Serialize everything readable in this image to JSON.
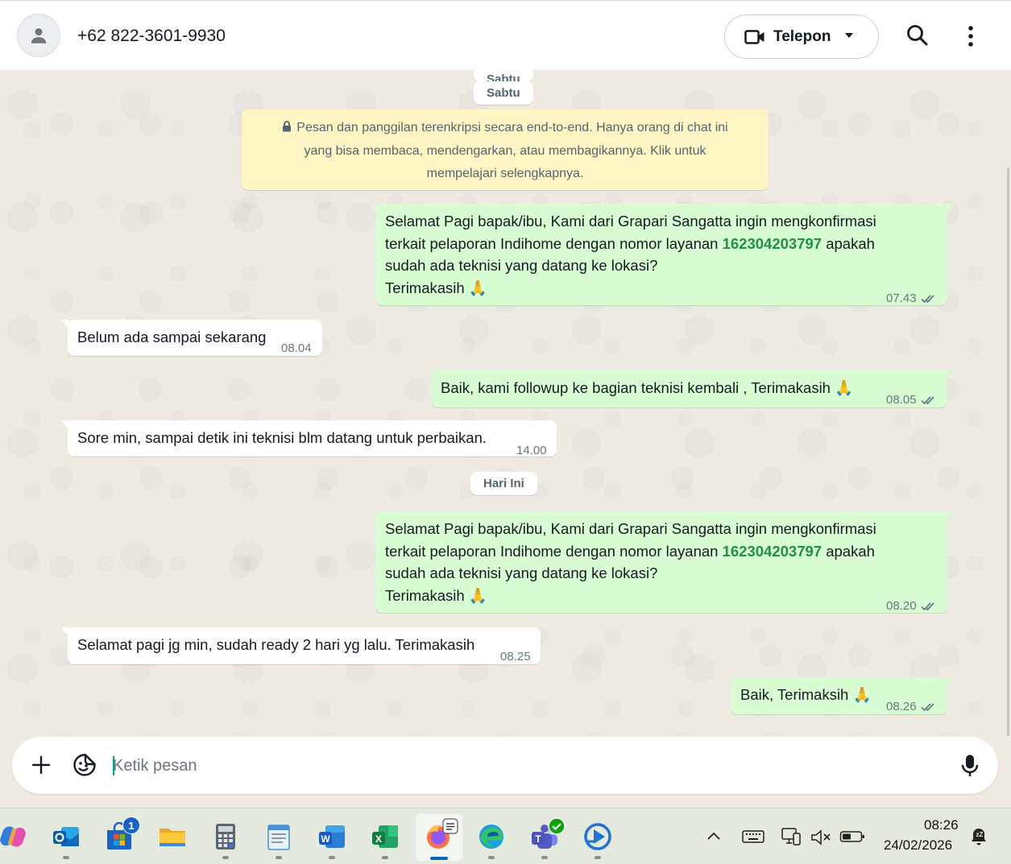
{
  "header": {
    "contact_name": "+62 822-3601-9930",
    "call_label": "Telepon"
  },
  "chat": {
    "date_sabtu_peek": "Sabtu",
    "date_sabtu": "Sabtu",
    "encryption_notice": "Pesan dan panggilan terenkripsi secara end-to-end. Hanya orang di chat ini yang bisa membaca, mendengarkan, atau membagikannya. Klik untuk mempelajari selengkapnya.",
    "date_today": "Hari Ini",
    "messages": [
      {
        "direction": "out",
        "line1": "Selamat Pagi bapak/ibu, Kami dari Grapari Sangatta ingin mengkonfirmasi",
        "line2_pre": "terkait pelaporan Indihome dengan nomor layanan ",
        "line2_link": "162304203797",
        "line2_post": " apakah",
        "line3": "sudah ada teknisi yang datang ke lokasi?",
        "line4": "Terimakasih 🙏",
        "time": "07.43",
        "status": "read"
      },
      {
        "direction": "in",
        "text": "Belum ada sampai sekarang",
        "time": "08.04"
      },
      {
        "direction": "out",
        "text": "Baik, kami followup ke bagian teknisi kembali , Terimakasih 🙏",
        "time": "08.05",
        "status": "read"
      },
      {
        "direction": "in",
        "text": "Sore min, sampai detik ini teknisi blm datang untuk perbaikan.",
        "time": "14.00"
      },
      {
        "direction": "out",
        "line1": "Selamat Pagi bapak/ibu, Kami dari Grapari Sangatta ingin mengkonfirmasi",
        "line2_pre": "terkait pelaporan Indihome dengan nomor layanan ",
        "line2_link": "162304203797",
        "line2_post": " apakah",
        "line3": "sudah ada teknisi yang datang ke lokasi?",
        "line4": "Terimakasih 🙏",
        "time": "08.20",
        "status": "read"
      },
      {
        "direction": "in",
        "text": "Selamat pagi jg min, sudah ready 2 hari yg lalu. Terimakasih",
        "time": "08.25"
      },
      {
        "direction": "out",
        "text": "Baik, Terimaksih 🙏",
        "time": "08.26",
        "status": "read"
      }
    ]
  },
  "composer": {
    "placeholder": "Ketik pesan",
    "value": ""
  },
  "taskbar": {
    "apps": [
      "copilot-icon",
      "outlook-icon",
      "store-icon",
      "file-explorer-icon",
      "calculator-icon",
      "notepad-icon",
      "word-icon",
      "excel-icon",
      "firefox-icon",
      "edge-icon",
      "teams-icon",
      "player-icon"
    ],
    "store_badge": "1",
    "time": "08:26",
    "date": "24/02/2026"
  },
  "colors": {
    "outgoing_bubble": "#d9fdd3",
    "incoming_bubble": "#ffffff",
    "link": "#1f8f4d",
    "chat_background": "#efeae2",
    "notice_background": "#fff5c4"
  }
}
